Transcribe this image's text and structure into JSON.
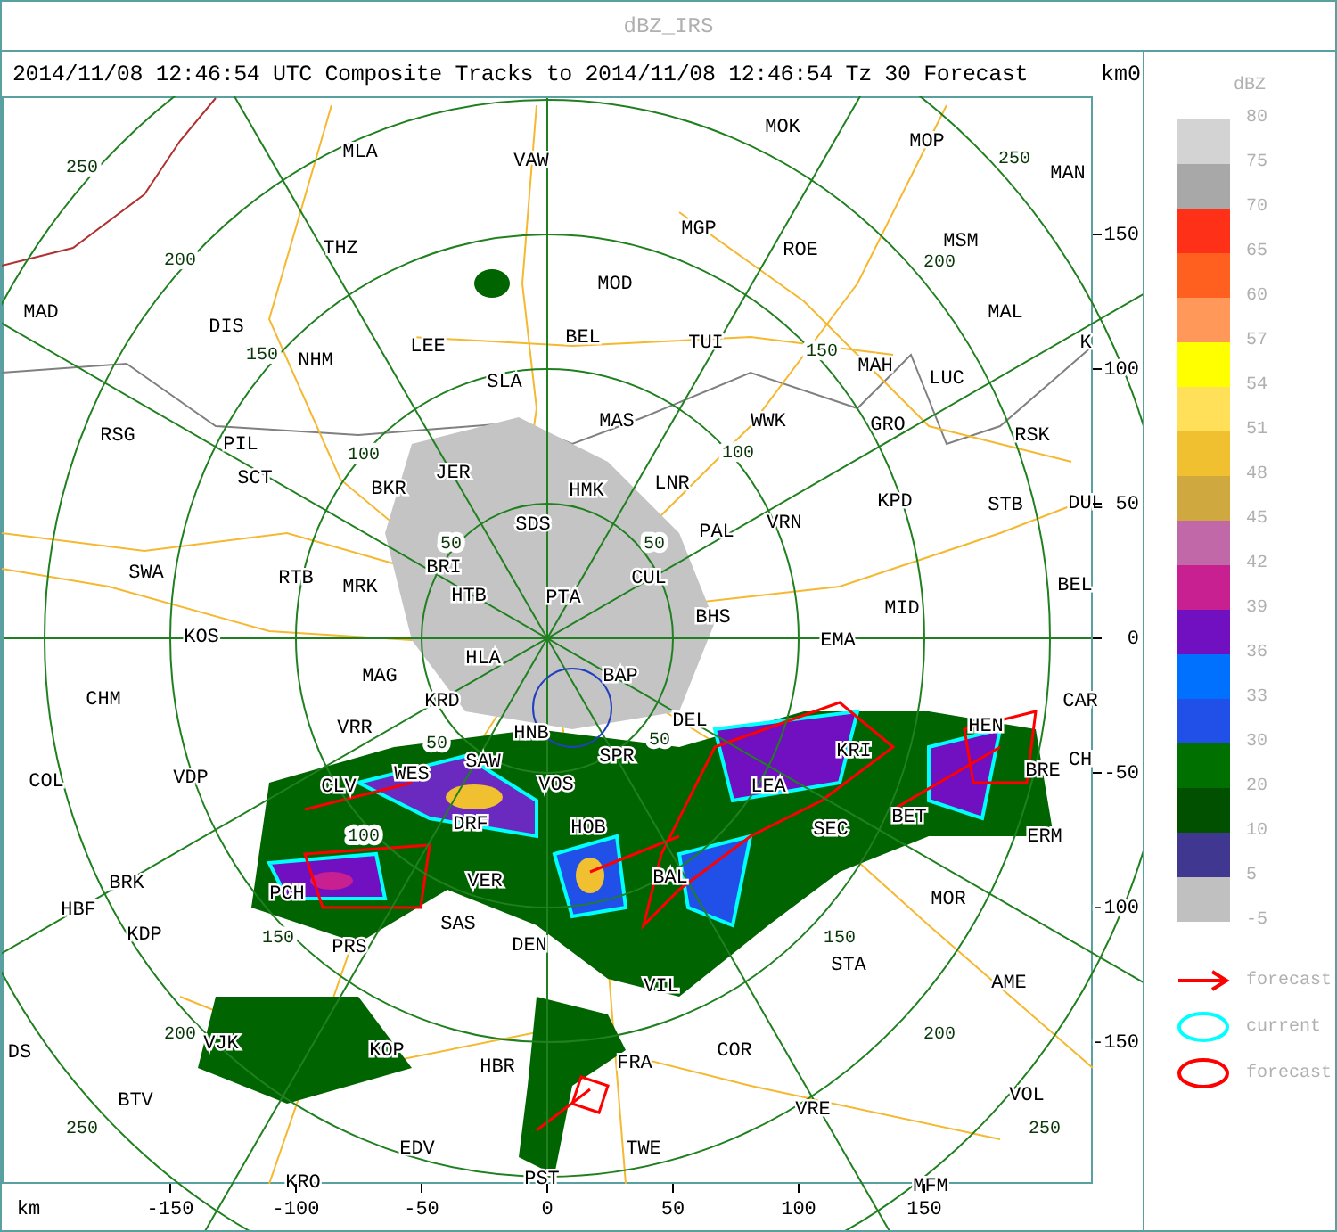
{
  "window": {
    "title": "dBZ_IRS"
  },
  "plot": {
    "title": "2014/11/08 12:46:54 UTC Composite Tracks to 2014/11/08 12:46:54 Tz 30 Forecast",
    "corner_unit": "km",
    "corner_value": "0",
    "stations": [
      "MLA",
      "VAW",
      "MOK",
      "MOP",
      "MAN",
      "THZ",
      "MGP",
      "ROE",
      "MSM",
      "MOD",
      "MAD",
      "DIS",
      "LEE",
      "BEL",
      "TUI",
      "MAH",
      "LUC",
      "MAL",
      "K",
      "NHM",
      "SLA",
      "RSG",
      "PIL",
      "MAS",
      "WWK",
      "GRO",
      "RSK",
      "SCT",
      "BKR",
      "JER",
      "HMK",
      "LNR",
      "KPD",
      "STB",
      "DUL",
      "SDS",
      "PAL",
      "VRN",
      "SWA",
      "RTB",
      "MRK",
      "BRI",
      "HTB",
      "PTA",
      "CUL",
      "BHS",
      "MID",
      "BEL",
      "KOS",
      "EMA",
      "HLA",
      "MAG",
      "BAP",
      "CHM",
      "KRD",
      "CAR",
      "VRR",
      "DEL",
      "HEN",
      "HNB",
      "SAW",
      "SPR",
      "WES",
      "COL",
      "VDP",
      "CLV",
      "VOS",
      "LEA",
      "KRI",
      "BRE",
      "CH",
      "DRF",
      "HOB",
      "SEC",
      "BET",
      "ERM",
      "PCH",
      "VER",
      "BAL",
      "BRK",
      "HBF",
      "KDP",
      "SAS",
      "MOR",
      "PRS",
      "DEN",
      "STA",
      "AME",
      "VIL",
      "DS",
      "VJK",
      "KOP",
      "HBR",
      "FRA",
      "COR",
      "BTV",
      "VRE",
      "VOL",
      "EDV",
      "TWE",
      "KRO",
      "PST",
      "MFM"
    ],
    "range_labels": [
      "50",
      "50",
      "50",
      "50",
      "100",
      "100",
      "100",
      "150",
      "150",
      "150",
      "150",
      "200",
      "200",
      "200",
      "200",
      "250",
      "250",
      "250",
      "250"
    ],
    "x_axis": {
      "unit": "km",
      "ticks": [
        "-150",
        "-100",
        "-50",
        "0",
        "50",
        "100",
        "150"
      ]
    },
    "y_axis": {
      "ticks": [
        "150",
        "100",
        "50",
        "0",
        "-50",
        "-100",
        "-150"
      ]
    }
  },
  "legend": {
    "unit": "dBZ",
    "swatches": [
      {
        "color": "#d3d3d3",
        "label": "80"
      },
      {
        "color": "#a8a8a8",
        "label": "75"
      },
      {
        "color": "#ff3018",
        "label": "70"
      },
      {
        "color": "#ff6020",
        "label": "65"
      },
      {
        "color": "#ff9858",
        "label": "60"
      },
      {
        "color": "#ffff00",
        "label": "57"
      },
      {
        "color": "#ffe058",
        "label": "54"
      },
      {
        "color": "#f0c030",
        "label": "51"
      },
      {
        "color": "#d0a840",
        "label": "48"
      },
      {
        "color": "#c068a8",
        "label": "45"
      },
      {
        "color": "#c82090",
        "label": "42"
      },
      {
        "color": "#7010c0",
        "label": "39"
      },
      {
        "color": "#0070ff",
        "label": "36"
      },
      {
        "color": "#2050e8",
        "label": "33"
      },
      {
        "color": "#007000",
        "label": "30"
      },
      {
        "color": "#005000",
        "label": "20"
      },
      {
        "color": "#403890",
        "label": "10"
      },
      {
        "color": "#c0c0c0",
        "label": "5"
      }
    ],
    "bottom_label": "-5",
    "keys": [
      {
        "kind": "arrow",
        "label": "forecast"
      },
      {
        "kind": "current",
        "label": "current"
      },
      {
        "kind": "forecast",
        "label": "forecast"
      }
    ]
  }
}
